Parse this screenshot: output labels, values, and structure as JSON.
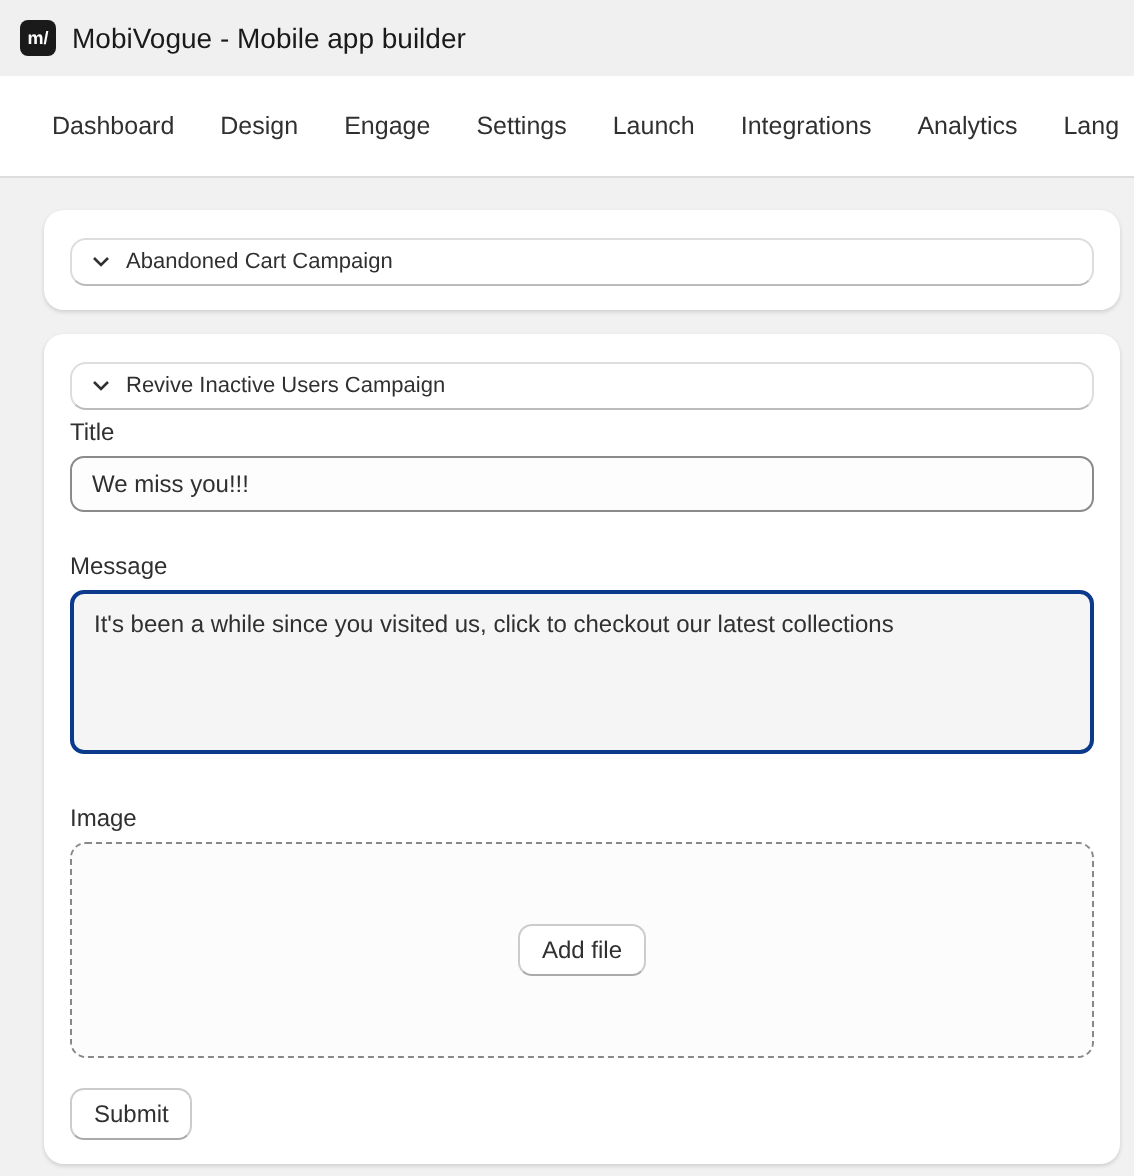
{
  "window": {
    "title": "MobiVogue - Mobile app builder",
    "logo": "m/"
  },
  "nav": [
    {
      "label": "Dashboard"
    },
    {
      "label": "Design"
    },
    {
      "label": "Engage"
    },
    {
      "label": "Settings"
    },
    {
      "label": "Launch"
    },
    {
      "label": "Integrations"
    },
    {
      "label": "Analytics"
    },
    {
      "label": "Lang"
    }
  ],
  "campaigns": [
    {
      "title": "Abandoned Cart Campaign"
    },
    {
      "title": "Revive Inactive Users Campaign",
      "form": {
        "title": {
          "label": "Title",
          "value": "We miss you!!!"
        },
        "message": {
          "label": "Message",
          "value": "It's been a while since you visited us, click to checkout our latest collections",
          "focused": true
        },
        "image": {
          "label": "Image",
          "button": "Add file"
        },
        "submit": "Submit"
      }
    }
  ]
}
